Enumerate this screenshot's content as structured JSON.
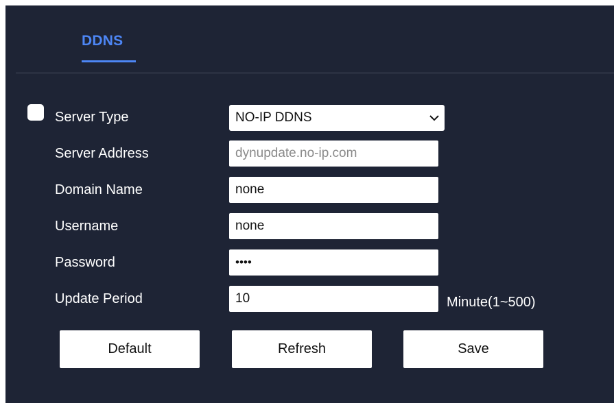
{
  "tab": {
    "label": "DDNS"
  },
  "form": {
    "server_type": {
      "label": "Server Type",
      "value": "NO-IP DDNS"
    },
    "server_address": {
      "label": "Server Address",
      "value": "dynupdate.no-ip.com"
    },
    "domain_name": {
      "label": "Domain Name",
      "value": "none"
    },
    "username": {
      "label": "Username",
      "value": "none"
    },
    "password": {
      "label": "Password",
      "value": "••••"
    },
    "update_period": {
      "label": "Update Period",
      "value": "10",
      "suffix": "Minute(1~500)"
    }
  },
  "buttons": {
    "default_label": "Default",
    "refresh_label": "Refresh",
    "save_label": "Save"
  },
  "colors": {
    "panel_bg": "#1e2435",
    "accent": "#4d86f5"
  }
}
